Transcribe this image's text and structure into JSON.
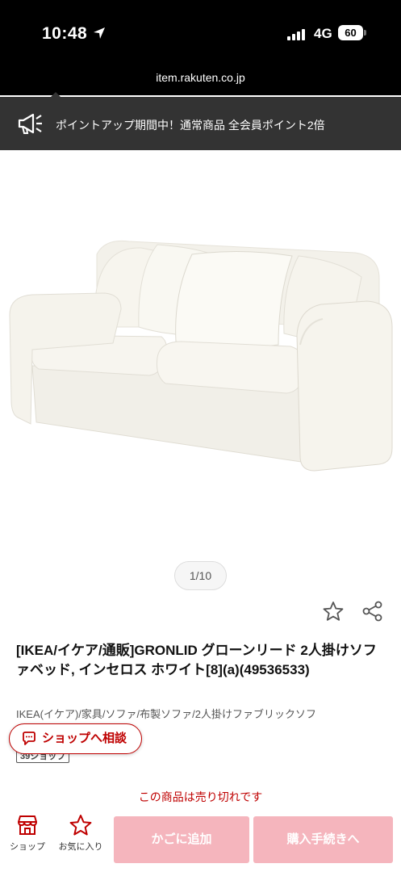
{
  "status_bar": {
    "time": "10:48",
    "network": "4G",
    "battery": "60"
  },
  "browser": {
    "url": "item.rakuten.co.jp"
  },
  "promo": {
    "text": "ポイントアップ期間中！通常商品 全会員ポイント2倍"
  },
  "gallery": {
    "pager": "1/10"
  },
  "product": {
    "title": "[IKEA/イケア/通販]GRONLID グローンリード 2人掛けソファベッド, インセロス ホワイト[8](a)(49536533)",
    "breadcrumb": "IKEA(イケア)/家具/ソファ/布製ソファ/2人掛けファブリックソフ",
    "shop_tag": "39ショップ"
  },
  "consult_button": {
    "label": "ショップへ相談"
  },
  "availability": {
    "text": "この商品は売り切れです"
  },
  "bottom_nav": {
    "shop_label": "ショップ",
    "favorite_label": "お気に入り",
    "cart_label": "かごに追加",
    "buy_label": "購入手続きへ"
  },
  "colors": {
    "brand_red": "#bf0000",
    "disabled_button": "#f5b5bd",
    "banner": "#333333"
  }
}
